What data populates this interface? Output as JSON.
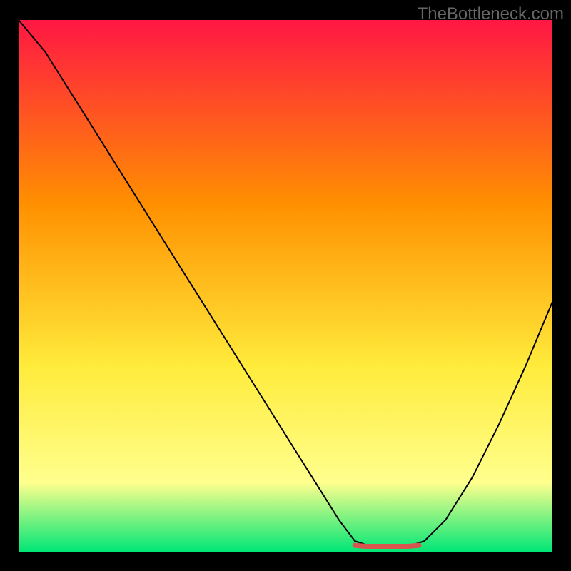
{
  "watermark": "TheBottleneck.com",
  "chart_data": {
    "type": "line",
    "title": "",
    "xlabel": "",
    "ylabel": "",
    "xlim": [
      0,
      100
    ],
    "ylim": [
      0,
      100
    ],
    "gradient_colors": {
      "top": "#ff1744",
      "upper_mid": "#ff9100",
      "mid": "#ffeb3b",
      "lower": "#ffff8d",
      "bottom": "#00e676"
    },
    "series": [
      {
        "name": "bottleneck-curve",
        "color": "#000000",
        "x": [
          0,
          5,
          10,
          15,
          20,
          25,
          30,
          35,
          40,
          45,
          50,
          55,
          60,
          63,
          66,
          70,
          73,
          76,
          80,
          85,
          90,
          95,
          100
        ],
        "y": [
          100,
          94,
          86,
          78,
          70,
          62,
          54,
          46,
          38,
          30,
          22,
          14,
          6,
          2,
          1,
          1,
          1,
          2,
          6,
          14,
          24,
          35,
          47
        ]
      },
      {
        "name": "optimal-marker",
        "color": "#d9534f",
        "type": "scatter",
        "x": [
          63,
          65,
          67,
          69,
          71,
          73,
          75
        ],
        "y": [
          1.2,
          1,
          1,
          1,
          1,
          1,
          1.2
        ]
      }
    ],
    "optimal_range": {
      "start": 63,
      "end": 76
    }
  }
}
